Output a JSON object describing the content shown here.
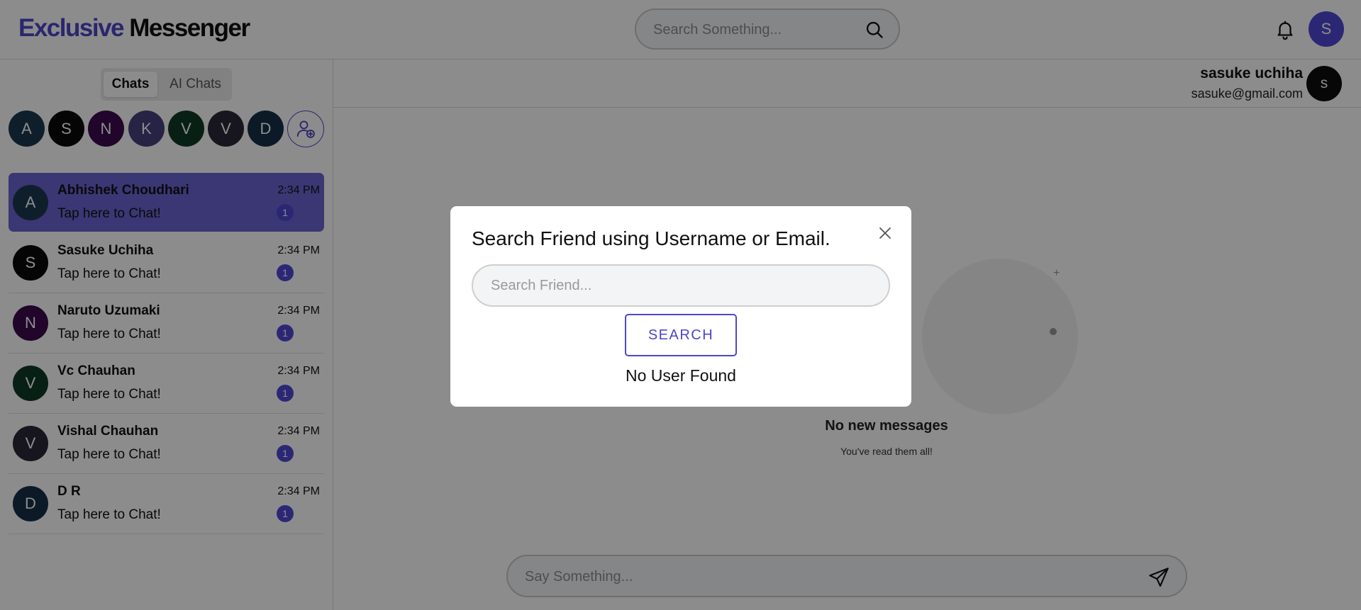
{
  "brand": {
    "part1": "Exclusive",
    "part2": "Messenger",
    "color": "#4f46c9"
  },
  "header": {
    "search_placeholder": "Search Something...",
    "user_initial": "S",
    "user_avatar_color": "#5147d6"
  },
  "sidebar": {
    "tabs": [
      {
        "label": "Chats",
        "active": true
      },
      {
        "label": "AI Chats",
        "active": false
      }
    ],
    "quick_avatars": [
      {
        "initial": "A",
        "color": "#1a3a4f"
      },
      {
        "initial": "S",
        "color": "#0a0a0a"
      },
      {
        "initial": "N",
        "color": "#3d0a4d"
      },
      {
        "initial": "K",
        "color": "#46407e"
      },
      {
        "initial": "V",
        "color": "#0f3b26"
      },
      {
        "initial": "V",
        "color": "#2a2838"
      },
      {
        "initial": "D",
        "color": "#163048"
      }
    ],
    "chats": [
      {
        "initial": "A",
        "color": "#1a3a4f",
        "name": "Abhishek Choudhari",
        "message": "Tap here to Chat!",
        "time": "2:34 PM",
        "unread": "1",
        "active": true
      },
      {
        "initial": "S",
        "color": "#0a0a0a",
        "name": "Sasuke Uchiha",
        "message": "Tap here to Chat!",
        "time": "2:34 PM",
        "unread": "1",
        "active": false
      },
      {
        "initial": "N",
        "color": "#3d0a4d",
        "name": "Naruto Uzumaki",
        "message": "Tap here to Chat!",
        "time": "2:34 PM",
        "unread": "1",
        "active": false
      },
      {
        "initial": "V",
        "color": "#0f3b26",
        "name": "Vc Chauhan",
        "message": "Tap here to Chat!",
        "time": "2:34 PM",
        "unread": "1",
        "active": false
      },
      {
        "initial": "V",
        "color": "#2a2838",
        "name": "Vishal Chauhan",
        "message": "Tap here to Chat!",
        "time": "2:34 PM",
        "unread": "1",
        "active": false
      },
      {
        "initial": "D",
        "color": "#163048",
        "name": "D R",
        "message": "Tap here to Chat!",
        "time": "2:34 PM",
        "unread": "1",
        "active": false
      }
    ]
  },
  "main": {
    "contact": {
      "name": "sasuke uchiha",
      "email": "sasuke@gmail.com",
      "initial": "s"
    },
    "empty_title": "No new messages",
    "empty_subtitle": "You've read them all!",
    "input_placeholder": "Say Something..."
  },
  "modal": {
    "title": "Search Friend using Username or Email.",
    "input_placeholder": "Search Friend...",
    "button_label": "SEARCH",
    "result_text": "No User Found"
  }
}
